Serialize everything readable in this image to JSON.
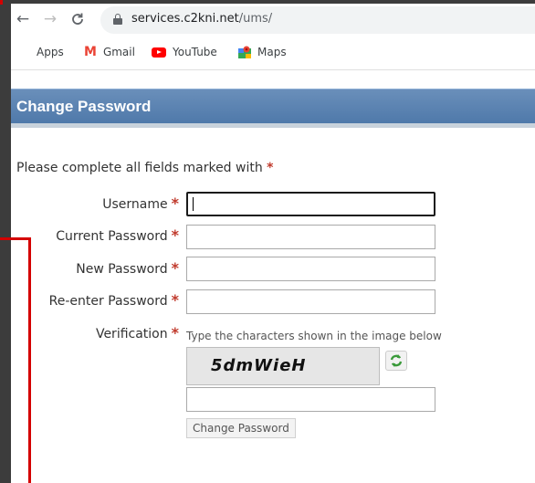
{
  "browser": {
    "url_host": "services.c2kni.net",
    "url_path": "/ums/",
    "bookmarks": [
      {
        "label": "Apps",
        "icon": "apps-grid-icon"
      },
      {
        "label": "Gmail",
        "icon": "gmail-icon"
      },
      {
        "label": "YouTube",
        "icon": "youtube-icon"
      },
      {
        "label": "Maps",
        "icon": "maps-icon"
      }
    ]
  },
  "page": {
    "title": "Change Password",
    "intro": "Please complete all fields marked with",
    "required_marker": "*"
  },
  "form": {
    "username_label": "Username",
    "current_password_label": "Current Password",
    "new_password_label": "New Password",
    "reenter_password_label": "Re-enter Password",
    "verification_label": "Verification",
    "verification_hint": "Type the characters shown in the image below",
    "captcha_text": "5dmWieH",
    "submit_label": "Change Password"
  },
  "colors": {
    "header_band": "#5a82b0",
    "required": "#c0392b",
    "annotation": "#d40000"
  }
}
